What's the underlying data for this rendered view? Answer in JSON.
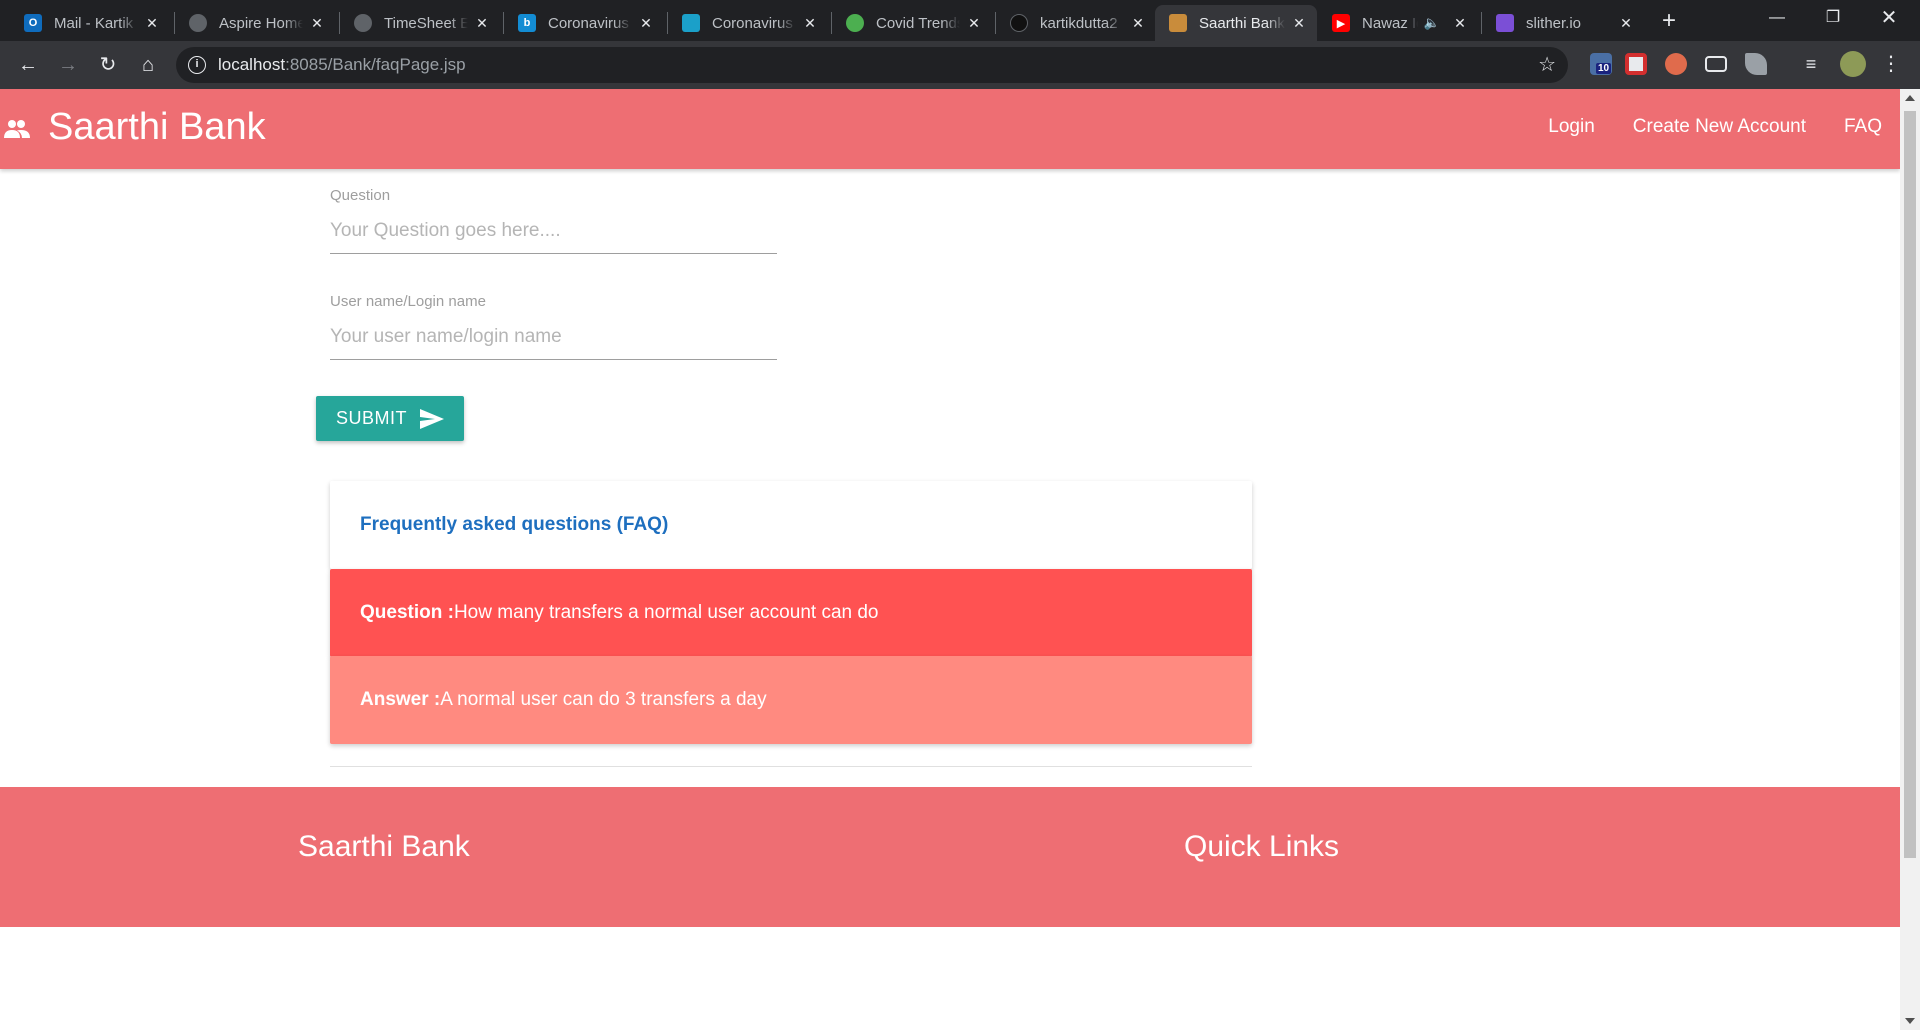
{
  "browser": {
    "tabs": [
      {
        "title": "Mail - Kartik Dutta",
        "icon": "outlook-icon",
        "color": "#0f6cbd"
      },
      {
        "title": "Aspire Home",
        "icon": "globe-icon",
        "color": "#9aa0a6"
      },
      {
        "title": "TimeSheet Entry",
        "icon": "globe-icon",
        "color": "#9aa0a6"
      },
      {
        "title": "Coronavirus",
        "icon": "bing-icon",
        "color": "#138cd3"
      },
      {
        "title": "Coronavirus",
        "icon": "tracker-icon",
        "color": "#1ba0c9"
      },
      {
        "title": "Covid Trends",
        "icon": "virus-icon",
        "color": "#4caf50"
      },
      {
        "title": "kartikdutta2",
        "icon": "github-icon",
        "color": "#202124"
      },
      {
        "title": "Saarthi Bank",
        "icon": "bank-icon",
        "color": "#c98c3b"
      },
      {
        "title": "Nawaz Iq",
        "icon": "youtube-icon",
        "color": "#ff0000"
      },
      {
        "title": "slither.io",
        "icon": "slither-icon",
        "color": "#7b4fd6"
      }
    ],
    "url_host": "localhost",
    "url_path": ":8085/Bank/faqPage.jsp",
    "extension_badge": "10"
  },
  "navbar": {
    "brand": "Saarthi Bank",
    "links": [
      "Login",
      "Create New Account",
      "FAQ"
    ]
  },
  "form": {
    "question_label": "Question",
    "question_placeholder": "Your Question goes here....",
    "username_label": "User name/Login name",
    "username_placeholder": "Your user name/login name",
    "submit_label": "SUBMIT"
  },
  "faq": {
    "heading": "Frequently asked questions (FAQ)",
    "question_prefix": "Question :",
    "question_text": "How many transfers a normal user account can do",
    "answer_prefix": "Answer :",
    "answer_text": "A normal user can do 3 transfers a day"
  },
  "footer": {
    "brand": "Saarthi Bank",
    "quick_links": "Quick Links"
  },
  "colors": {
    "navbar": "#ee6e73",
    "submit": "#26a69a",
    "question_card": "#ff5252",
    "answer_card": "#ff8a80",
    "faq_heading": "#1e6fbf"
  }
}
